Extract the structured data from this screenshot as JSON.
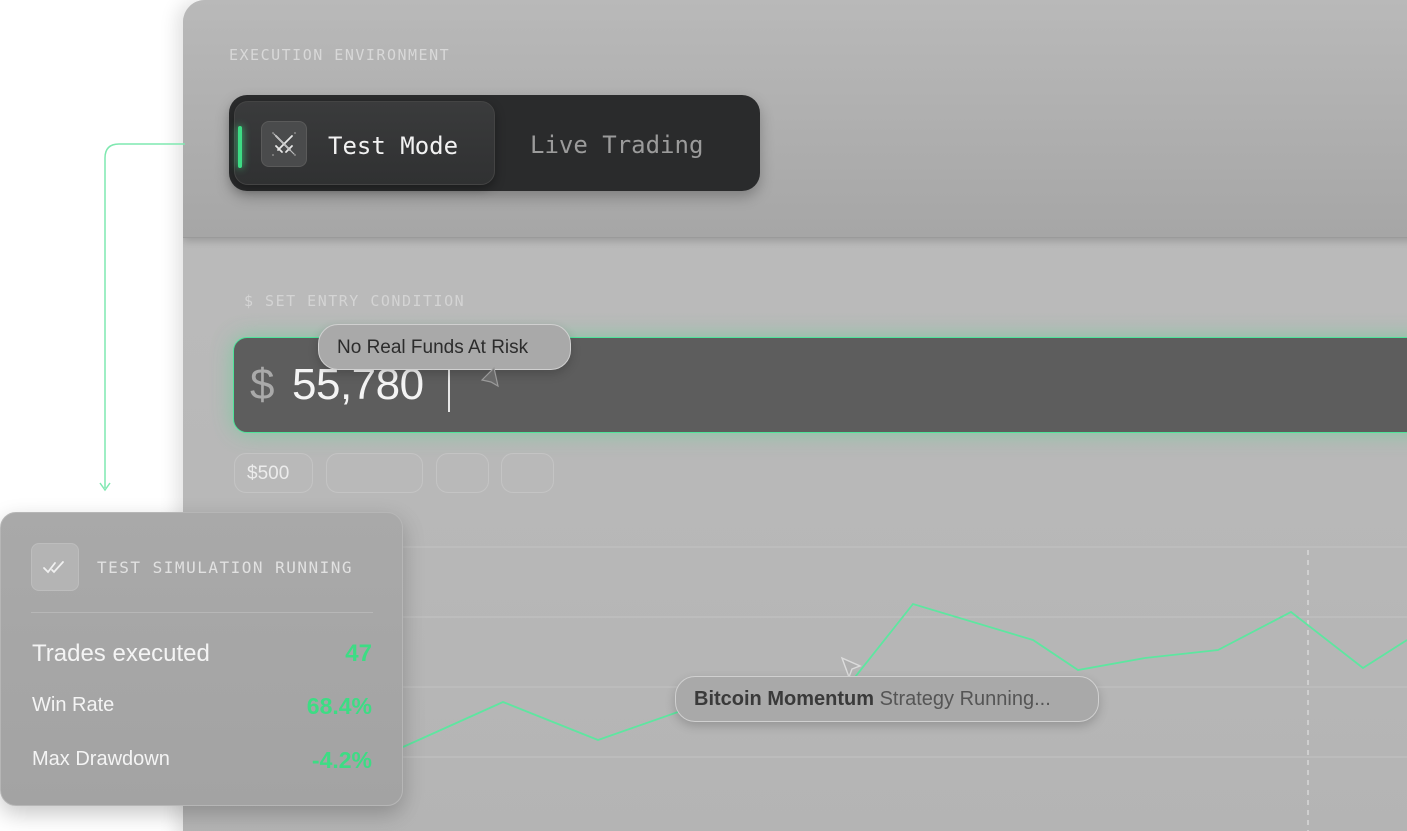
{
  "environment": {
    "label": "EXECUTION ENVIRONMENT",
    "modes": [
      {
        "label": "Test Mode",
        "active": true,
        "icon": "crossed-swords-icon"
      },
      {
        "label": "Live Trading",
        "active": false
      }
    ]
  },
  "entry": {
    "label": "$ SET ENTRY CONDITION",
    "currency_symbol": "$",
    "value": "55,780",
    "quick_amounts": [
      "$500",
      "",
      "",
      ""
    ]
  },
  "tooltips": {
    "funds": "No Real Funds At Risk",
    "strategy_name": "Bitcoin Momentum",
    "strategy_status": "Strategy Running..."
  },
  "simulation": {
    "title": "TEST SIMULATION RUNNING",
    "icon": "double-check-icon",
    "stats": [
      {
        "label": "Trades executed",
        "value": "47"
      },
      {
        "label": "Win Rate",
        "value": "68.4%"
      },
      {
        "label": "Max Drawdown",
        "value": "-4.2%"
      }
    ]
  },
  "colors": {
    "accent_green": "#3ddc84",
    "switch_bg": "#2a2b2c",
    "input_bg": "#5d5d5d"
  }
}
